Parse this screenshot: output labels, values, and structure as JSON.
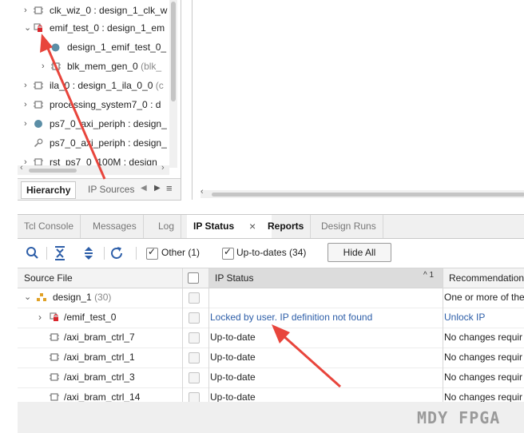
{
  "hierarchy": {
    "rows": [
      {
        "name": "clk_wiz_0 : design_1_clk_w",
        "detail": ""
      },
      {
        "name": "emif_test_0 : design_1_em",
        "detail": ""
      },
      {
        "name": "design_1_emif_test_0_",
        "detail": ""
      },
      {
        "name": "blk_mem_gen_0",
        "detail": "(blk_"
      },
      {
        "name": "ila_0 : design_1_ila_0_0",
        "detail": "(c"
      },
      {
        "name": "processing_system7_0 : d",
        "detail": ""
      },
      {
        "name": "ps7_0_axi_periph : design_",
        "detail": ""
      },
      {
        "name": "ps7_0_axi_periph : design_",
        "detail": ""
      },
      {
        "name": "rst_ps7_0_100M : design",
        "detail": ""
      }
    ],
    "tabs": [
      "Hierarchy",
      "IP Sources"
    ],
    "tab_controls": [
      "◀",
      "▶",
      "≡"
    ]
  },
  "bottom": {
    "tabs": [
      "Tcl Console",
      "Messages",
      "Log",
      "IP Status",
      "Reports",
      "Design Runs"
    ],
    "close_glyph": "×",
    "toolbar": {
      "checkbox_other": "Other (1)",
      "checkbox_uptodate": "Up-to-dates (34)",
      "hide_all": "Hide All"
    },
    "table": {
      "headers": [
        "Source File",
        "IP Status",
        "Recommendation"
      ],
      "sort_indicator": "^ 1",
      "rows": [
        {
          "file": "design_1",
          "count": "(30)",
          "status": "",
          "rec": "One or more of the"
        },
        {
          "file": "/emif_test_0",
          "count": "",
          "status": "Locked by user. IP definition not found",
          "rec": "Unlock IP"
        },
        {
          "file": "/axi_bram_ctrl_7",
          "count": "",
          "status": "Up-to-date",
          "rec": "No changes requir"
        },
        {
          "file": "/axi_bram_ctrl_1",
          "count": "",
          "status": "Up-to-date",
          "rec": "No changes requir"
        },
        {
          "file": "/axi_bram_ctrl_3",
          "count": "",
          "status": "Up-to-date",
          "rec": "No changes requir"
        },
        {
          "file": "/axi_bram_ctrl_14",
          "count": "",
          "status": "Up-to-date",
          "rec": "No changes requir"
        }
      ]
    },
    "watermark": "MDY FPGA"
  },
  "colors": {
    "annotation_arrow": "#e8453c",
    "link": "#2d5ea8",
    "lock": "#d9262c"
  }
}
